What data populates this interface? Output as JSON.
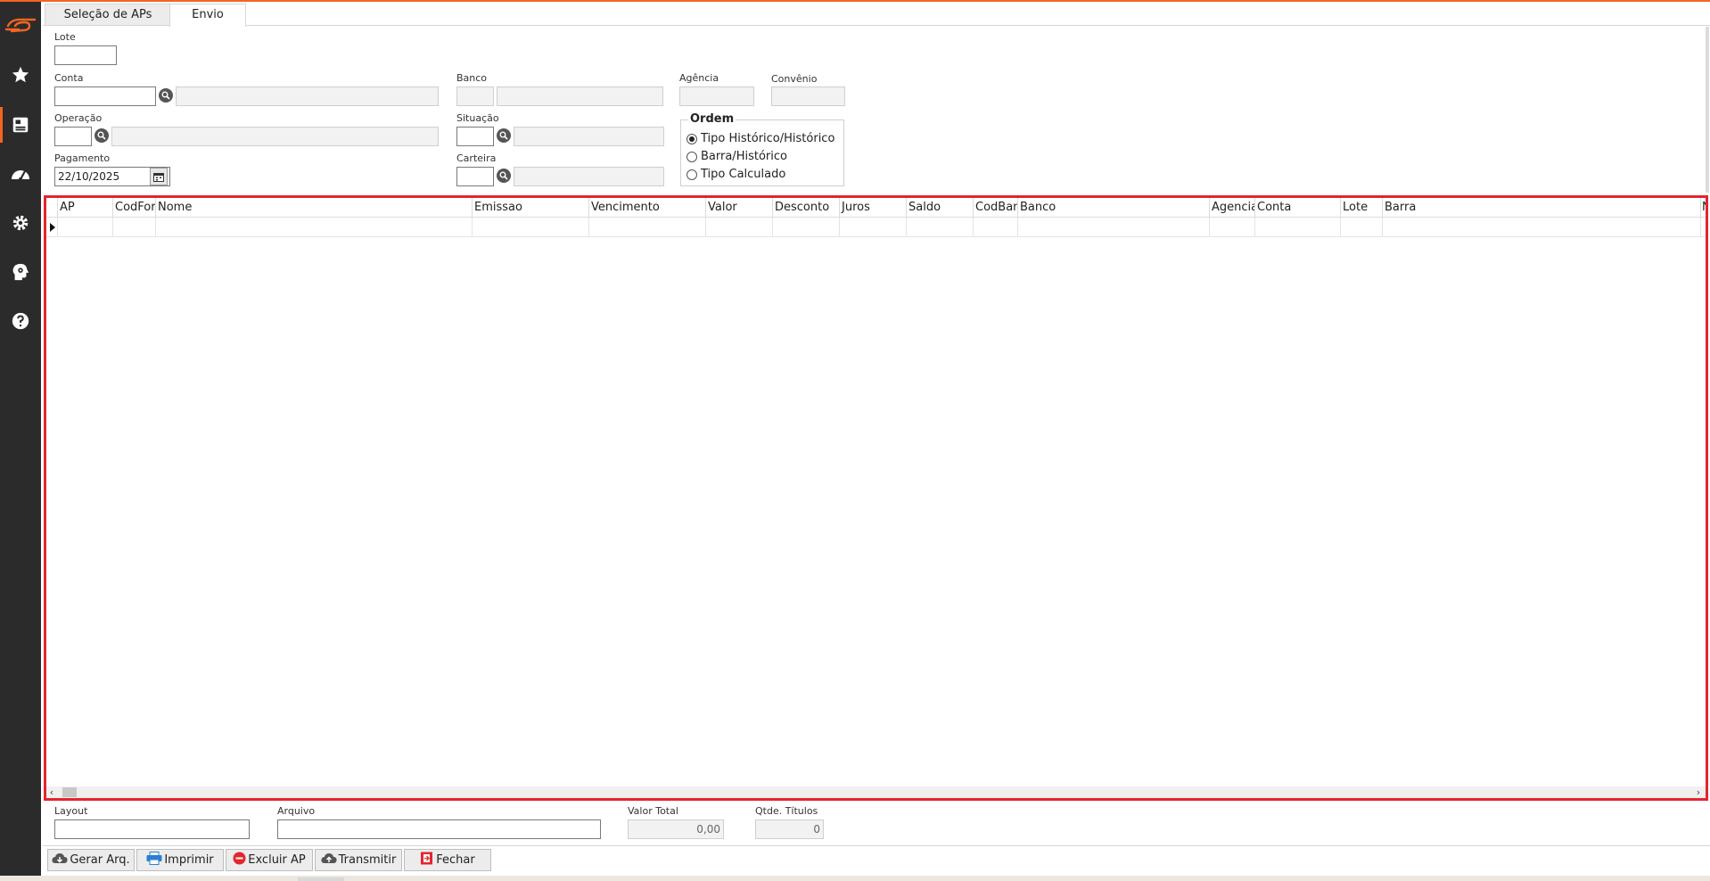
{
  "app": {
    "accent": "#f26522",
    "grid_border": "#e3262d"
  },
  "sidebar": {
    "items": [
      {
        "icon": "logo-icon"
      },
      {
        "icon": "star-icon"
      },
      {
        "icon": "register-icon"
      },
      {
        "icon": "dashboard-icon"
      },
      {
        "icon": "gear-icon"
      },
      {
        "icon": "head-gear-icon"
      },
      {
        "icon": "help-icon"
      }
    ]
  },
  "tabs": [
    {
      "label": "Seleção de APs"
    },
    {
      "label": "Envio"
    }
  ],
  "form": {
    "lote_label": "Lote",
    "lote_value": "",
    "conta_label": "Conta",
    "conta_value": "",
    "conta_desc": "",
    "banco_label": "Banco",
    "banco_value": "",
    "banco_desc": "",
    "agencia_label": "Agência",
    "agencia_value": "",
    "convenio_label": "Convênio",
    "convenio_value": "",
    "operacao_label": "Operação",
    "operacao_value": "",
    "operacao_desc": "",
    "situacao_label": "Situação",
    "situacao_value": "",
    "situacao_desc": "",
    "pagamento_label": "Pagamento",
    "pagamento_value": "22/10/2025",
    "carteira_label": "Carteira",
    "carteira_value": "",
    "carteira_desc": ""
  },
  "ordem": {
    "title": "Ordem",
    "options": [
      {
        "label": "Tipo Histórico/Histórico",
        "checked": true
      },
      {
        "label": "Barra/Histórico",
        "checked": false
      },
      {
        "label": "Tipo Calculado",
        "checked": false
      }
    ]
  },
  "grid": {
    "columns": [
      "AP",
      "CodFor",
      "Nome",
      "Emissao",
      "Vencimento",
      "Valor",
      "Desconto",
      "Juros",
      "Saldo",
      "CodBan",
      "Banco",
      "Agencia",
      "Conta",
      "Lote",
      "Barra",
      "N"
    ]
  },
  "footer": {
    "layout_label": "Layout",
    "layout_value": "",
    "arquivo_label": "Arquivo",
    "arquivo_value": "",
    "valor_total_label": "Valor Total",
    "valor_total_value": "0,00",
    "qtde_label": "Qtde. Títulos",
    "qtde_value": "0"
  },
  "buttons": {
    "gerar": "Gerar Arq.",
    "imprimir": "Imprimir",
    "excluir": "Excluir AP",
    "transmitir": "Transmitir",
    "fechar": "Fechar"
  }
}
